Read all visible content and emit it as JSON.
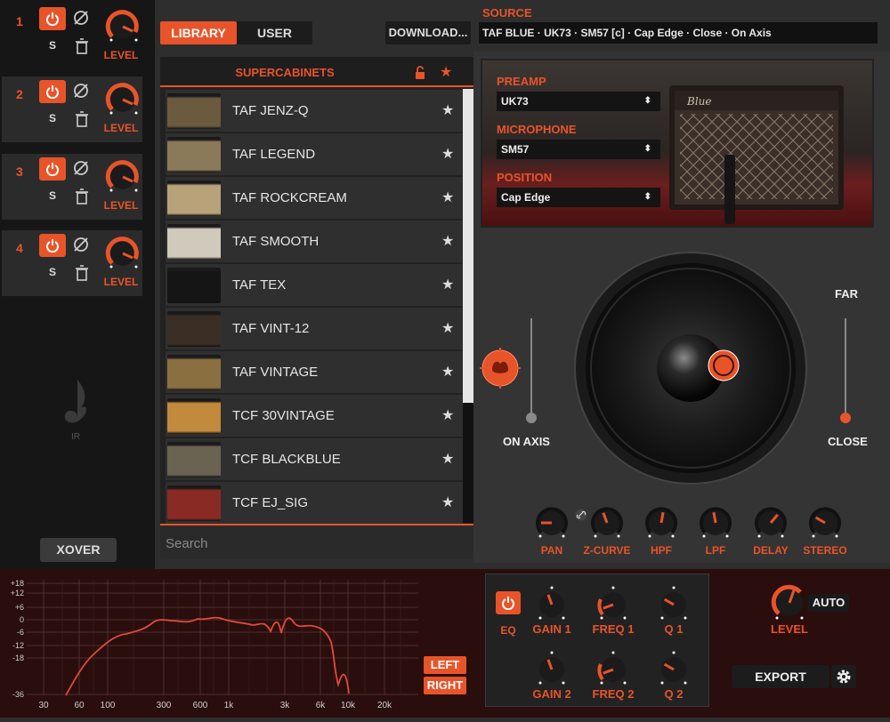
{
  "slots": [
    {
      "num": "1",
      "solo": "S",
      "level_label": "LEVEL"
    },
    {
      "num": "2",
      "solo": "S",
      "level_label": "LEVEL"
    },
    {
      "num": "3",
      "solo": "S",
      "level_label": "LEVEL"
    },
    {
      "num": "4",
      "solo": "S",
      "level_label": "LEVEL"
    }
  ],
  "ir_logo_text": "IR",
  "xover_label": "XOVER",
  "tabs": {
    "library": "LIBRARY",
    "user": "USER"
  },
  "download_label": "DOWNLOAD...",
  "library": {
    "title": "SUPERCABINETS",
    "items": [
      {
        "name": "TAF JENZ-Q",
        "thumb": "#6b5a3e"
      },
      {
        "name": "TAF LEGEND",
        "thumb": "#8a7a5a"
      },
      {
        "name": "TAF ROCKCREAM",
        "thumb": "#b8a27a"
      },
      {
        "name": "TAF SMOOTH",
        "thumb": "#cfcabb"
      },
      {
        "name": "TAF TEX",
        "thumb": "#151515"
      },
      {
        "name": "TAF VINT-12",
        "thumb": "#3b2f25"
      },
      {
        "name": "TAF VINTAGE",
        "thumb": "#8a7040"
      },
      {
        "name": "TCF 30VINTAGE",
        "thumb": "#c28a3c"
      },
      {
        "name": "TCF BLACKBLUE",
        "thumb": "#6a6352"
      },
      {
        "name": "TCF EJ_SIG",
        "thumb": "#8a2a25"
      }
    ],
    "search_placeholder": "Search"
  },
  "source": {
    "label": "SOURCE",
    "text": "TAF BLUE · UK73 · SM57 [c] · Cap Edge · Close · On Axis"
  },
  "preamp": {
    "label": "PREAMP",
    "value": "UK73"
  },
  "microphone": {
    "label": "MICROPHONE",
    "value": "SM57"
  },
  "position": {
    "label": "POSITION",
    "value": "Cap Edge"
  },
  "mic_axis": {
    "on_axis": "ON AXIS",
    "far": "FAR",
    "close": "CLOSE"
  },
  "bottom_knobs": [
    "PAN",
    "Z-CURVE",
    "HPF",
    "LPF",
    "DELAY",
    "STEREO"
  ],
  "eq": {
    "y_ticks": [
      "+18",
      "+12",
      "+6",
      "0",
      "-6",
      "-12",
      "-18",
      "-36"
    ],
    "x_ticks": [
      "30",
      "60",
      "100",
      "300",
      "600",
      "1k",
      "3k",
      "6k",
      "10k",
      "20k"
    ],
    "left_label": "LEFT",
    "right_label": "RIGHT",
    "eq_label": "EQ",
    "knobs": [
      "GAIN 1",
      "FREQ 1",
      "Q 1",
      "GAIN 2",
      "FREQ 2",
      "Q 2"
    ]
  },
  "output": {
    "level_label": "LEVEL",
    "auto_label": "AUTO",
    "export_label": "EXPORT"
  },
  "colors": {
    "accent": "#e8542a",
    "panel": "#2e2e2e",
    "eq_bg": "#2a0d0d"
  }
}
